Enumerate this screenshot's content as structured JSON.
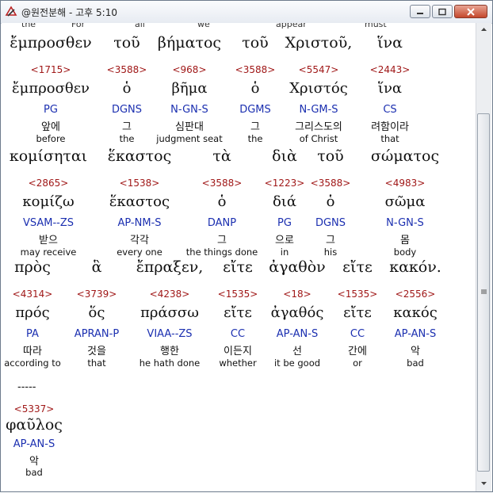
{
  "window": {
    "title": "@원전분해 - 고후 5:10"
  },
  "top_strip": [
    "the",
    "For",
    "all",
    "we",
    "appear",
    "must"
  ],
  "blocks": [
    {
      "cols": [
        {
          "grk": "ἔμπροσθεν",
          "num": "<1715>",
          "lem": "ἔμπροσθεν",
          "parse": "PG",
          "kor": "앞에",
          "eng": "before"
        },
        {
          "grk": "τοῦ",
          "num": "<3588>",
          "lem": "ὁ",
          "parse": "DGNS",
          "kor": "그",
          "eng": "the"
        },
        {
          "grk": "βήματος",
          "num": "<968>",
          "lem": "βῆμα",
          "parse": "N-GN-S",
          "kor": "심판대",
          "eng": "judgment seat"
        },
        {
          "grk": "τοῦ",
          "num": "<3588>",
          "lem": "ὁ",
          "parse": "DGMS",
          "kor": "그",
          "eng": "the"
        },
        {
          "grk": "Χριστοῦ,",
          "num": "<5547>",
          "lem": "Χριστός",
          "parse": "N-GM-S",
          "kor": "그리스도의",
          "eng": "of Christ"
        },
        {
          "grk": "ἵνα",
          "num": "<2443>",
          "lem": "ἵνα",
          "parse": "CS",
          "kor": "려함이라",
          "eng": "that"
        }
      ]
    },
    {
      "cols": [
        {
          "grk": "κομίσηται",
          "num": "<2865>",
          "lem": "κομίζω",
          "parse": "VSAM--ZS",
          "kor": "받으",
          "eng": "may receive"
        },
        {
          "grk": "ἕκαστος",
          "num": "<1538>",
          "lem": "ἕκαστος",
          "parse": "AP-NM-S",
          "kor": "각각",
          "eng": "every one"
        },
        {
          "grk": "τὰ",
          "num": "<3588>",
          "lem": "ὁ",
          "parse": "DANP",
          "kor": "그",
          "eng": "the things done"
        },
        {
          "grk": "διὰ",
          "num": "<1223>",
          "lem": "διά",
          "parse": "PG",
          "kor": "으로",
          "eng": "in"
        },
        {
          "grk": "τοῦ",
          "num": "<3588>",
          "lem": "ὁ",
          "parse": "DGNS",
          "kor": "그",
          "eng": "his"
        },
        {
          "grk": "σώματος",
          "num": "<4983>",
          "lem": "σῶμα",
          "parse": "N-GN-S",
          "kor": "몸",
          "eng": "body"
        }
      ]
    },
    {
      "cols": [
        {
          "grk": "πρὸς",
          "num": "<4314>",
          "lem": "πρός",
          "parse": "PA",
          "kor": "따라",
          "eng": "according to"
        },
        {
          "grk": "ἃ",
          "num": "<3739>",
          "lem": "ὅς",
          "parse": "APRAN-P",
          "kor": "것을",
          "eng": "that"
        },
        {
          "grk": "ἔπραξεν,",
          "num": "<4238>",
          "lem": "πράσσω",
          "parse": "VIAA--ZS",
          "kor": "행한",
          "eng": "he hath done"
        },
        {
          "grk": "εἴτε",
          "num": "<1535>",
          "lem": "εἴτε",
          "parse": "CC",
          "kor": "이든지",
          "eng": "whether"
        },
        {
          "grk": "ἀγαθὸν",
          "num": "<18>",
          "lem": "ἀγαθός",
          "parse": "AP-AN-S",
          "kor": "선",
          "eng": "it be good"
        },
        {
          "grk": "εἴτε",
          "num": "<1535>",
          "lem": "εἴτε",
          "parse": "CC",
          "kor": "간에",
          "eng": "or"
        },
        {
          "grk": "κακόν.",
          "num": "<2556>",
          "lem": "κακός",
          "parse": "AP-AN-S",
          "kor": "악",
          "eng": "bad"
        }
      ]
    },
    {
      "cols": [
        {
          "grk": "φαῦλος",
          "num": "<5337>",
          "lem": "",
          "parse": "AP-AN-S",
          "kor": "악",
          "eng": "bad"
        }
      ]
    }
  ],
  "separator": "-----",
  "colors": {
    "greek": "#111111",
    "strongs": "#a01818",
    "parsing": "#1b2fb0"
  }
}
